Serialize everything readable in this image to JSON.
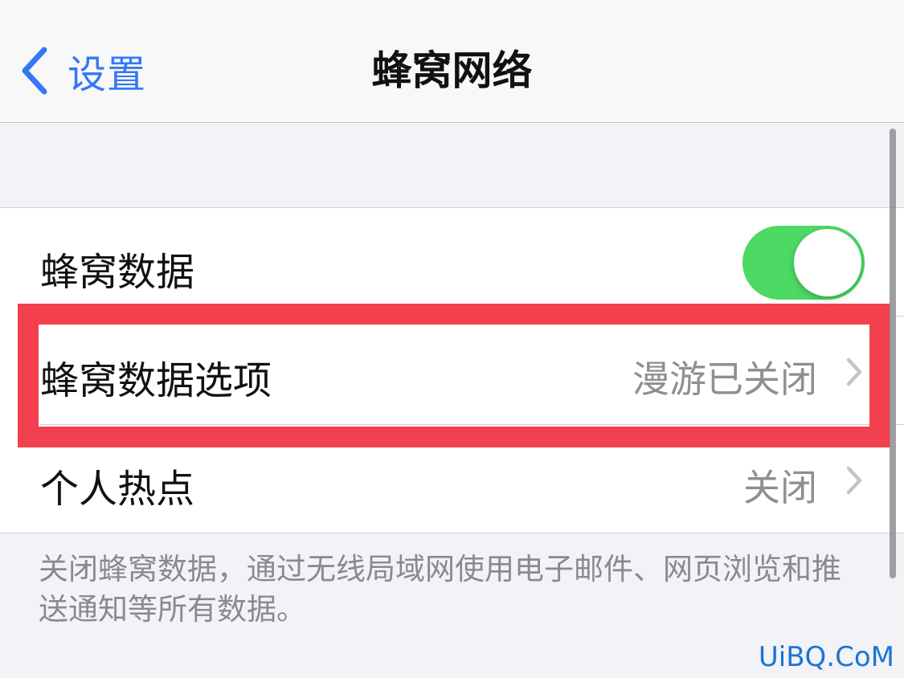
{
  "nav": {
    "back_label": "设置",
    "title": "蜂窝网络"
  },
  "rows": [
    {
      "label": "蜂窝数据",
      "control": "toggle",
      "toggle_on": true
    },
    {
      "label": "蜂窝数据选项",
      "value": "漫游已关闭",
      "control": "chevron"
    },
    {
      "label": "个人热点",
      "value": "关闭",
      "control": "chevron"
    }
  ],
  "footer_text": "关闭蜂窝数据，通过无线局域网使用电子邮件、网页浏览和推送通知等所有数据。",
  "watermark": "UiBQ.CoM",
  "colors": {
    "accent": "#3478f6",
    "toggle_on": "#4cd964",
    "highlight": "#f2404f",
    "background": "#f2f2f7"
  },
  "icons": {
    "back": "chevron-left-icon",
    "disclosure": "chevron-right-icon"
  }
}
